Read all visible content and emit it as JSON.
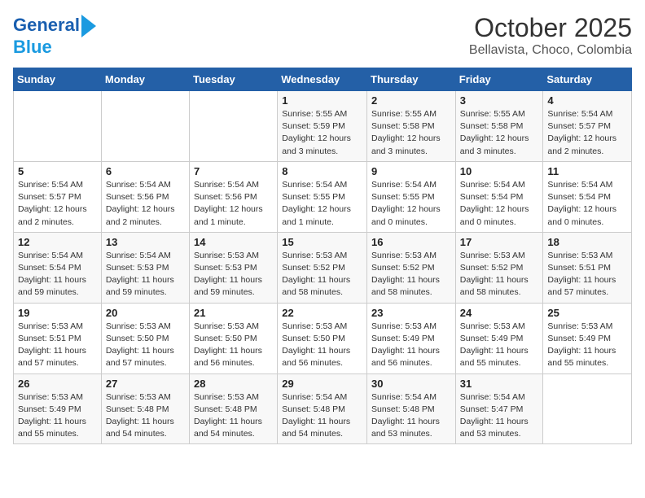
{
  "logo": {
    "line1": "General",
    "line2": "Blue"
  },
  "title": "October 2025",
  "subtitle": "Bellavista, Choco, Colombia",
  "weekdays": [
    "Sunday",
    "Monday",
    "Tuesday",
    "Wednesday",
    "Thursday",
    "Friday",
    "Saturday"
  ],
  "weeks": [
    [
      {
        "day": "",
        "info": ""
      },
      {
        "day": "",
        "info": ""
      },
      {
        "day": "",
        "info": ""
      },
      {
        "day": "1",
        "info": "Sunrise: 5:55 AM\nSunset: 5:59 PM\nDaylight: 12 hours\nand 3 minutes."
      },
      {
        "day": "2",
        "info": "Sunrise: 5:55 AM\nSunset: 5:58 PM\nDaylight: 12 hours\nand 3 minutes."
      },
      {
        "day": "3",
        "info": "Sunrise: 5:55 AM\nSunset: 5:58 PM\nDaylight: 12 hours\nand 3 minutes."
      },
      {
        "day": "4",
        "info": "Sunrise: 5:54 AM\nSunset: 5:57 PM\nDaylight: 12 hours\nand 2 minutes."
      }
    ],
    [
      {
        "day": "5",
        "info": "Sunrise: 5:54 AM\nSunset: 5:57 PM\nDaylight: 12 hours\nand 2 minutes."
      },
      {
        "day": "6",
        "info": "Sunrise: 5:54 AM\nSunset: 5:56 PM\nDaylight: 12 hours\nand 2 minutes."
      },
      {
        "day": "7",
        "info": "Sunrise: 5:54 AM\nSunset: 5:56 PM\nDaylight: 12 hours\nand 1 minute."
      },
      {
        "day": "8",
        "info": "Sunrise: 5:54 AM\nSunset: 5:55 PM\nDaylight: 12 hours\nand 1 minute."
      },
      {
        "day": "9",
        "info": "Sunrise: 5:54 AM\nSunset: 5:55 PM\nDaylight: 12 hours\nand 0 minutes."
      },
      {
        "day": "10",
        "info": "Sunrise: 5:54 AM\nSunset: 5:54 PM\nDaylight: 12 hours\nand 0 minutes."
      },
      {
        "day": "11",
        "info": "Sunrise: 5:54 AM\nSunset: 5:54 PM\nDaylight: 12 hours\nand 0 minutes."
      }
    ],
    [
      {
        "day": "12",
        "info": "Sunrise: 5:54 AM\nSunset: 5:54 PM\nDaylight: 11 hours\nand 59 minutes."
      },
      {
        "day": "13",
        "info": "Sunrise: 5:54 AM\nSunset: 5:53 PM\nDaylight: 11 hours\nand 59 minutes."
      },
      {
        "day": "14",
        "info": "Sunrise: 5:53 AM\nSunset: 5:53 PM\nDaylight: 11 hours\nand 59 minutes."
      },
      {
        "day": "15",
        "info": "Sunrise: 5:53 AM\nSunset: 5:52 PM\nDaylight: 11 hours\nand 58 minutes."
      },
      {
        "day": "16",
        "info": "Sunrise: 5:53 AM\nSunset: 5:52 PM\nDaylight: 11 hours\nand 58 minutes."
      },
      {
        "day": "17",
        "info": "Sunrise: 5:53 AM\nSunset: 5:52 PM\nDaylight: 11 hours\nand 58 minutes."
      },
      {
        "day": "18",
        "info": "Sunrise: 5:53 AM\nSunset: 5:51 PM\nDaylight: 11 hours\nand 57 minutes."
      }
    ],
    [
      {
        "day": "19",
        "info": "Sunrise: 5:53 AM\nSunset: 5:51 PM\nDaylight: 11 hours\nand 57 minutes."
      },
      {
        "day": "20",
        "info": "Sunrise: 5:53 AM\nSunset: 5:50 PM\nDaylight: 11 hours\nand 57 minutes."
      },
      {
        "day": "21",
        "info": "Sunrise: 5:53 AM\nSunset: 5:50 PM\nDaylight: 11 hours\nand 56 minutes."
      },
      {
        "day": "22",
        "info": "Sunrise: 5:53 AM\nSunset: 5:50 PM\nDaylight: 11 hours\nand 56 minutes."
      },
      {
        "day": "23",
        "info": "Sunrise: 5:53 AM\nSunset: 5:49 PM\nDaylight: 11 hours\nand 56 minutes."
      },
      {
        "day": "24",
        "info": "Sunrise: 5:53 AM\nSunset: 5:49 PM\nDaylight: 11 hours\nand 55 minutes."
      },
      {
        "day": "25",
        "info": "Sunrise: 5:53 AM\nSunset: 5:49 PM\nDaylight: 11 hours\nand 55 minutes."
      }
    ],
    [
      {
        "day": "26",
        "info": "Sunrise: 5:53 AM\nSunset: 5:49 PM\nDaylight: 11 hours\nand 55 minutes."
      },
      {
        "day": "27",
        "info": "Sunrise: 5:53 AM\nSunset: 5:48 PM\nDaylight: 11 hours\nand 54 minutes."
      },
      {
        "day": "28",
        "info": "Sunrise: 5:53 AM\nSunset: 5:48 PM\nDaylight: 11 hours\nand 54 minutes."
      },
      {
        "day": "29",
        "info": "Sunrise: 5:54 AM\nSunset: 5:48 PM\nDaylight: 11 hours\nand 54 minutes."
      },
      {
        "day": "30",
        "info": "Sunrise: 5:54 AM\nSunset: 5:48 PM\nDaylight: 11 hours\nand 53 minutes."
      },
      {
        "day": "31",
        "info": "Sunrise: 5:54 AM\nSunset: 5:47 PM\nDaylight: 11 hours\nand 53 minutes."
      },
      {
        "day": "",
        "info": ""
      }
    ]
  ]
}
